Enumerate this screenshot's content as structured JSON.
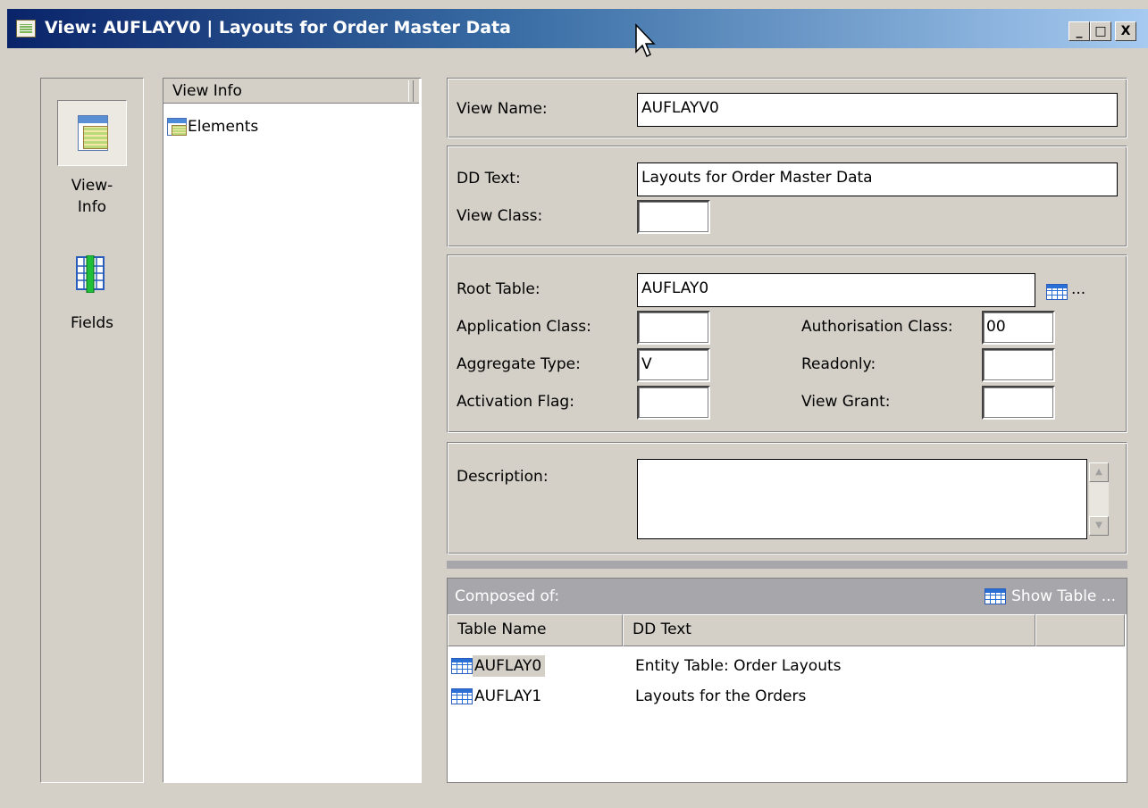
{
  "window": {
    "title": "View: AUFLAYV0 | Layouts for Order Master Data",
    "minimize": "_",
    "maximize": "□",
    "close": "X"
  },
  "nav": {
    "items": [
      {
        "label_line1": "View-",
        "label_line2": "Info",
        "icon": "view-info-icon"
      },
      {
        "label": "Fields",
        "icon": "fields-icon"
      }
    ]
  },
  "tree": {
    "header": "View Info",
    "items": [
      {
        "label": "Elements",
        "icon": "table-icon"
      }
    ]
  },
  "form": {
    "view_name_label": "View Name:",
    "view_name_value": "AUFLAYV0",
    "dd_text_label": "DD Text:",
    "dd_text_value": "Layouts for Order Master Data",
    "view_class_label": "View Class:",
    "view_class_value": "",
    "root_table_label": "Root Table:",
    "root_table_value": "AUFLAY0",
    "root_table_more": "...",
    "application_class_label": "Application Class:",
    "application_class_value": "",
    "authorisation_class_label": "Authorisation Class:",
    "authorisation_class_value": "00",
    "aggregate_type_label": "Aggregate Type:",
    "aggregate_type_value": "V",
    "readonly_label": "Readonly:",
    "readonly_value": "",
    "activation_flag_label": "Activation Flag:",
    "activation_flag_value": "",
    "view_grant_label": "View Grant:",
    "view_grant_value": "",
    "description_label": "Description:",
    "description_value": ""
  },
  "composed": {
    "title": "Composed of:",
    "show_table": "Show Table ...",
    "columns": [
      "Table Name",
      "DD Text"
    ],
    "rows": [
      {
        "table": "AUFLAY0",
        "dd_text": "Entity Table: Order Layouts",
        "selected": true
      },
      {
        "table": "AUFLAY1",
        "dd_text": "Layouts for the Orders",
        "selected": false
      }
    ]
  }
}
